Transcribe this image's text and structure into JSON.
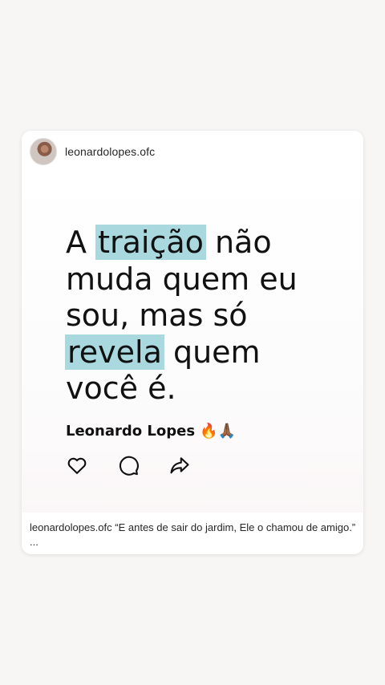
{
  "post": {
    "username": "leonardolopes.ofc",
    "quote": {
      "part1": "A ",
      "highlight1": "traição",
      "part2": " não muda quem eu sou, mas só ",
      "highlight2": "revela",
      "part3": " quem você é."
    },
    "author": "Leonardo Lopes",
    "author_emoji": "🔥🙏🏾",
    "actions": [
      "heart-icon",
      "comment-icon",
      "share-icon"
    ],
    "highlight_color": "#a9d9df"
  },
  "caption": {
    "username": "leonardolopes.ofc",
    "text": "“E antes de sair do jardim, Ele o chamou de amigo.”",
    "more": "..."
  }
}
